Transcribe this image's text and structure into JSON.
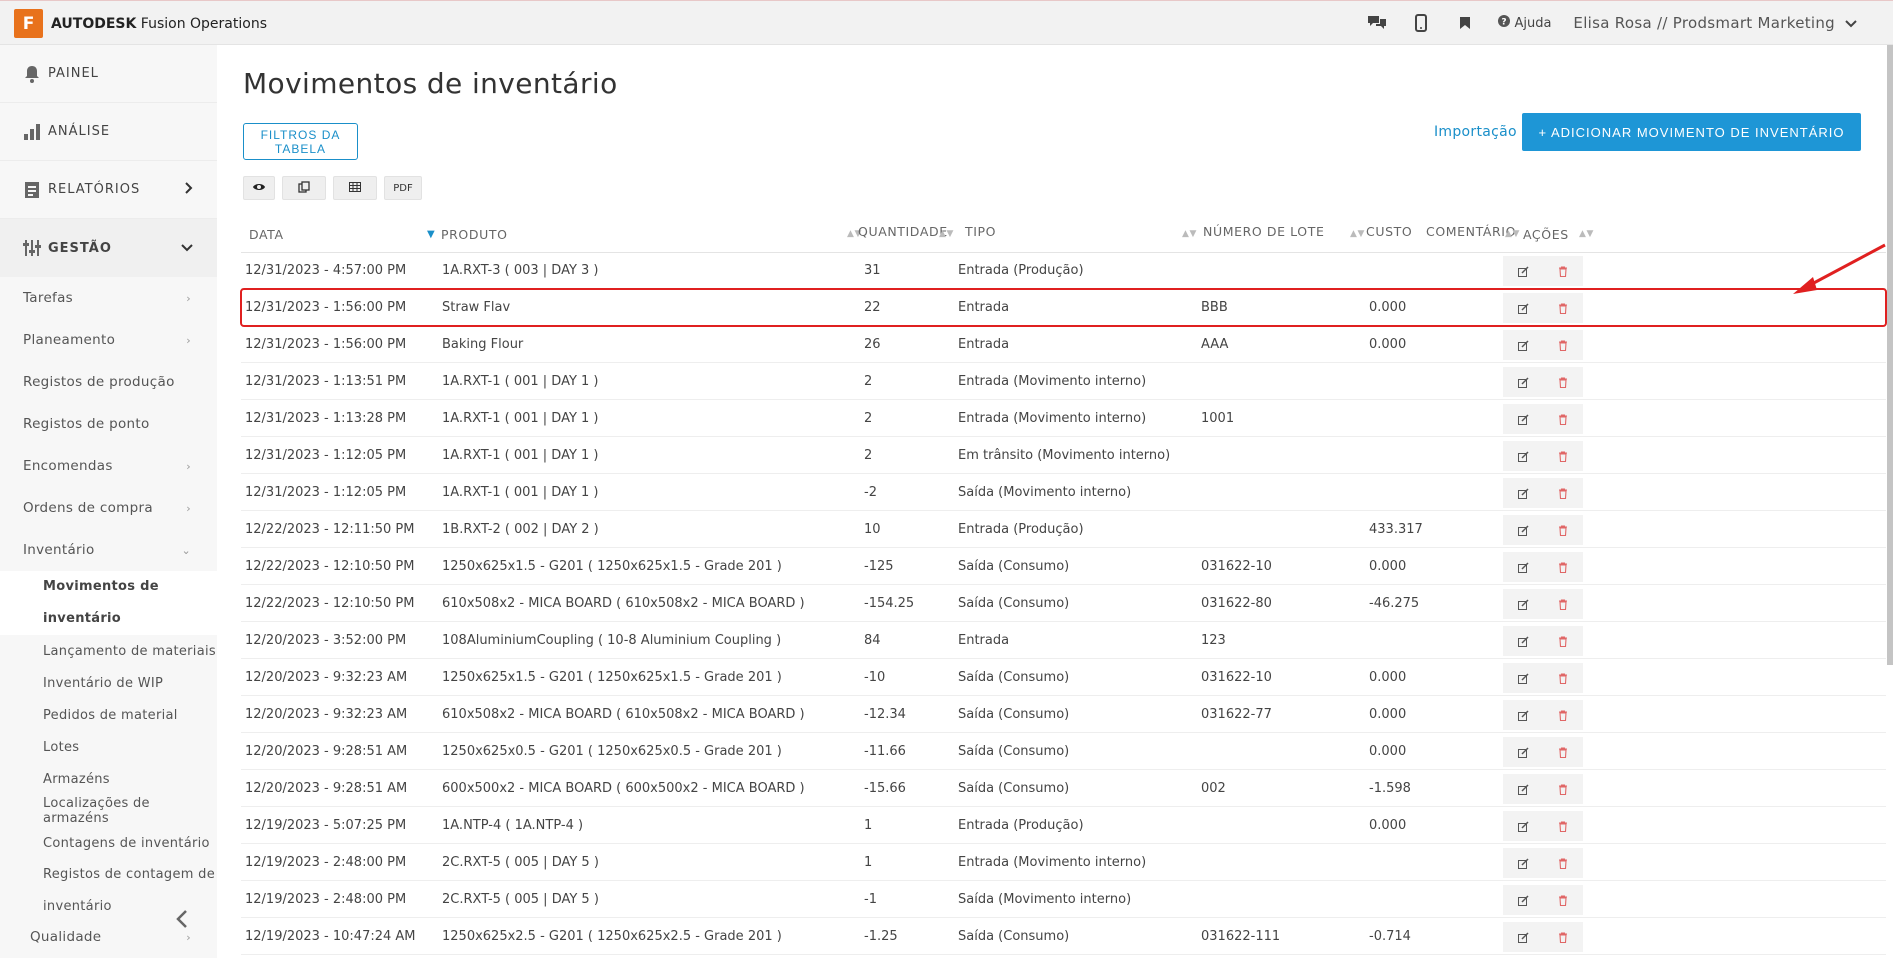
{
  "brand": {
    "logo_letter": "F",
    "name_bold": "AUTODESK",
    "name_rest": "Fusion Operations"
  },
  "topbar": {
    "help_label": "Ajuda",
    "user_label": "Elisa Rosa // Prodsmart Marketing"
  },
  "sidebar": {
    "main": [
      {
        "label": "PAINEL",
        "icon": "bell-icon"
      },
      {
        "label": "ANÁLISE",
        "icon": "bar-chart-icon"
      },
      {
        "label": "RELATÓRIOS",
        "icon": "report-icon"
      },
      {
        "label": "GESTÃO",
        "icon": "sliders-icon"
      }
    ],
    "sub": [
      {
        "label": "Tarefas"
      },
      {
        "label": "Planeamento"
      },
      {
        "label": "Registos de produção"
      },
      {
        "label": "Registos de ponto"
      },
      {
        "label": "Encomendas"
      },
      {
        "label": "Ordens de compra"
      },
      {
        "label": "Inventário"
      }
    ],
    "inventory_items": [
      {
        "label": "Movimentos de inventário"
      },
      {
        "label": "Lançamento de materiais"
      },
      {
        "label": "Inventário de WIP"
      },
      {
        "label": "Pedidos de material"
      },
      {
        "label": "Lotes"
      },
      {
        "label": "Armazéns"
      },
      {
        "label": "Localizações de armazéns"
      },
      {
        "label": "Contagens de inventário"
      },
      {
        "label": "Registos de contagem de inventário"
      }
    ],
    "bottom_item": "Qualidade"
  },
  "page": {
    "title": "Movimentos de inventário",
    "filters_label": "FILTROS DA TABELA",
    "import_label": "Importação",
    "add_label": "+ ADICIONAR MOVIMENTO DE INVENTÁRIO",
    "pdf_label": "PDF"
  },
  "table": {
    "headers": {
      "date": "DATA",
      "product": "PRODUTO",
      "quantity": "QUANTIDADE",
      "type": "TIPO",
      "lot": "NÚMERO DE LOTE",
      "cost": "CUSTO",
      "comment": "COMENTÁRIO",
      "actions": "AÇÕES"
    },
    "rows": [
      {
        "date": "12/31/2023 - 4:57:00 PM",
        "product": "1A.RXT-3 ( 003 | DAY 3 )",
        "qty": "31",
        "type": "Entrada (Produção)",
        "lot": "",
        "cost": ""
      },
      {
        "date": "12/31/2023 - 1:56:00 PM",
        "product": "Straw Flav",
        "qty": "22",
        "type": "Entrada",
        "lot": "BBB",
        "cost": "0.000"
      },
      {
        "date": "12/31/2023 - 1:56:00 PM",
        "product": "Baking Flour",
        "qty": "26",
        "type": "Entrada",
        "lot": "AAA",
        "cost": "0.000"
      },
      {
        "date": "12/31/2023 - 1:13:51 PM",
        "product": "1A.RXT-1 ( 001 | DAY 1 )",
        "qty": "2",
        "type": "Entrada (Movimento interno)",
        "lot": "",
        "cost": ""
      },
      {
        "date": "12/31/2023 - 1:13:28 PM",
        "product": "1A.RXT-1 ( 001 | DAY 1 )",
        "qty": "2",
        "type": "Entrada (Movimento interno)",
        "lot": "1001",
        "cost": ""
      },
      {
        "date": "12/31/2023 - 1:12:05 PM",
        "product": "1A.RXT-1 ( 001 | DAY 1 )",
        "qty": "2",
        "type": "Em trânsito (Movimento interno)",
        "lot": "",
        "cost": ""
      },
      {
        "date": "12/31/2023 - 1:12:05 PM",
        "product": "1A.RXT-1 ( 001 | DAY 1 )",
        "qty": "-2",
        "type": "Saída (Movimento interno)",
        "lot": "",
        "cost": ""
      },
      {
        "date": "12/22/2023 - 12:11:50 PM",
        "product": "1B.RXT-2 ( 002 | DAY 2 )",
        "qty": "10",
        "type": "Entrada (Produção)",
        "lot": "",
        "cost": "433.317"
      },
      {
        "date": "12/22/2023 - 12:10:50 PM",
        "product": "1250x625x1.5 - G201 ( 1250x625x1.5 - Grade 201 )",
        "qty": "-125",
        "type": "Saída (Consumo)",
        "lot": "031622-10",
        "cost": "0.000"
      },
      {
        "date": "12/22/2023 - 12:10:50 PM",
        "product": "610x508x2 - MICA BOARD ( 610x508x2 - MICA BOARD )",
        "qty": "-154.25",
        "type": "Saída (Consumo)",
        "lot": "031622-80",
        "cost": "-46.275"
      },
      {
        "date": "12/20/2023 - 3:52:00 PM",
        "product": "108AluminiumCoupling ( 10-8 Aluminium Coupling )",
        "qty": "84",
        "type": "Entrada",
        "lot": "123",
        "cost": ""
      },
      {
        "date": "12/20/2023 - 9:32:23 AM",
        "product": "1250x625x1.5 - G201 ( 1250x625x1.5 - Grade 201 )",
        "qty": "-10",
        "type": "Saída (Consumo)",
        "lot": "031622-10",
        "cost": "0.000"
      },
      {
        "date": "12/20/2023 - 9:32:23 AM",
        "product": "610x508x2 - MICA BOARD ( 610x508x2 - MICA BOARD )",
        "qty": "-12.34",
        "type": "Saída (Consumo)",
        "lot": "031622-77",
        "cost": "0.000"
      },
      {
        "date": "12/20/2023 - 9:28:51 AM",
        "product": "1250x625x0.5 - G201 ( 1250x625x0.5 - Grade 201 )",
        "qty": "-11.66",
        "type": "Saída (Consumo)",
        "lot": "",
        "cost": "0.000"
      },
      {
        "date": "12/20/2023 - 9:28:51 AM",
        "product": "600x500x2 - MICA BOARD ( 600x500x2 - MICA BOARD )",
        "qty": "-15.66",
        "type": "Saída (Consumo)",
        "lot": "002",
        "cost": "-1.598"
      },
      {
        "date": "12/19/2023 - 5:07:25 PM",
        "product": "1A.NTP-4 ( 1A.NTP-4 )",
        "qty": "1",
        "type": "Entrada (Produção)",
        "lot": "",
        "cost": "0.000"
      },
      {
        "date": "12/19/2023 - 2:48:00 PM",
        "product": "2C.RXT-5 ( 005 | DAY 5 )",
        "qty": "1",
        "type": "Entrada (Movimento interno)",
        "lot": "",
        "cost": ""
      },
      {
        "date": "12/19/2023 - 2:48:00 PM",
        "product": "2C.RXT-5 ( 005 | DAY 5 )",
        "qty": "-1",
        "type": "Saída (Movimento interno)",
        "lot": "",
        "cost": ""
      },
      {
        "date": "12/19/2023 - 10:47:24 AM",
        "product": "1250x625x2.5 - G201 ( 1250x625x2.5 - Grade 201 )",
        "qty": "-1.25",
        "type": "Saída (Consumo)",
        "lot": "031622-111",
        "cost": "-0.714"
      }
    ],
    "highlighted_row": 1
  },
  "colors": {
    "accent": "#1e96d6",
    "brand": "#e8721c",
    "highlight": "#e02020"
  }
}
